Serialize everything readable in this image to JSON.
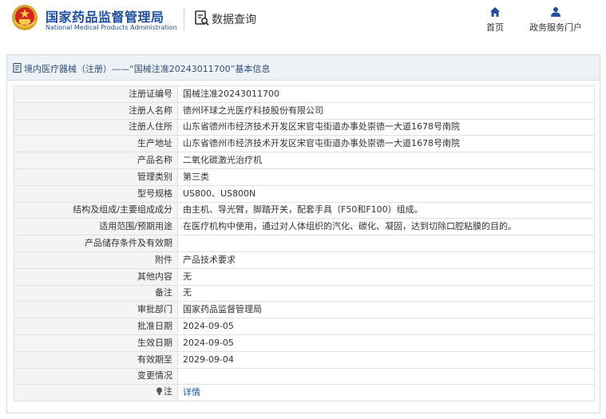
{
  "header": {
    "site_title_cn": "国家药品监督管理局",
    "site_title_en": "National Medical Products Administration",
    "query_title": "数据查询",
    "nav": [
      {
        "label": "首页",
        "icon": "home-icon"
      },
      {
        "label": "政务服务门户",
        "icon": "user-icon"
      }
    ]
  },
  "panel": {
    "title": "境内医疗器械（注册）——“国械注准20243011700”基本信息"
  },
  "rows": [
    {
      "key": "注册证编号",
      "value": "国械注准20243011700"
    },
    {
      "key": "注册人名称",
      "value": "德州环球之光医疗科技股份有限公司"
    },
    {
      "key": "注册人住所",
      "value": "山东省德州市经济技术开发区宋官屯街道办事处崇德一大道1678号南院"
    },
    {
      "key": "生产地址",
      "value": "山东省德州市经济技术开发区宋官屯街道办事处崇德一大道1678号南院"
    },
    {
      "key": "产品名称",
      "value": "二氧化碳激光治疗机"
    },
    {
      "key": "管理类别",
      "value": "第三类"
    },
    {
      "key": "型号规格",
      "value": "US800、US800N"
    },
    {
      "key": "结构及组成/主要组成成分",
      "value": "由主机、导光臂，脚踏开关，配套手具（F50和F100）组成。"
    },
    {
      "key": "适用范围/预期用途",
      "value": "在医疗机构中使用，通过对人体组织的汽化、碳化、凝固，达到切除口腔粘膜的目的。"
    },
    {
      "key": "产品储存条件及有效期",
      "value": ""
    },
    {
      "key": "附件",
      "value": "产品技术要求"
    },
    {
      "key": "其他内容",
      "value": "无"
    },
    {
      "key": "备注",
      "value": "无"
    },
    {
      "key": "审批部门",
      "value": "国家药品监督管理局"
    },
    {
      "key": "批准日期",
      "value": "2024-09-05"
    },
    {
      "key": "生效日期",
      "value": "2024-09-05"
    },
    {
      "key": "有效期至",
      "value": "2029-09-04"
    },
    {
      "key": "变更情况",
      "value": ""
    }
  ],
  "note": {
    "key": "注",
    "link": "详情",
    "icon": "lightbulb-icon"
  },
  "colors": {
    "brand_blue": "#1d4fa3",
    "link_blue": "#1d5aa8",
    "key_bg": "#f4f4f4",
    "bar_bg": "#eef1f5"
  }
}
